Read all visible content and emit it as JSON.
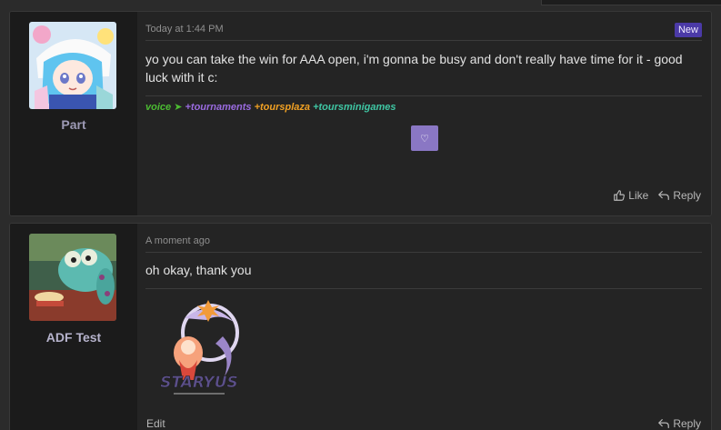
{
  "posts": [
    {
      "username": "Part",
      "timestamp": "Today at 1:44 PM",
      "badge": "New",
      "message": "yo you can take the win for AAA open, i'm gonna be busy and don't really have time for it - good luck with it c:",
      "signature": {
        "voice": "voice",
        "tournaments": "+tournaments",
        "toursplaza": "+toursplaza",
        "toursminigames": "+toursminigames"
      },
      "actions": {
        "like": "Like",
        "reply": "Reply"
      }
    },
    {
      "username": "ADF Test",
      "timestamp": "A moment ago",
      "message": "oh okay, thank you",
      "attachment_text": "STARYUS",
      "actions": {
        "edit": "Edit",
        "reply": "Reply"
      }
    }
  ],
  "colors": {
    "accent": "#4b3aa7",
    "signature_green": "#4cbc32",
    "signature_purple": "#9a6be0",
    "signature_orange": "#f0a023",
    "signature_teal": "#3fc7a4"
  },
  "icons": [
    "heart-icon",
    "like-icon",
    "reply-icon"
  ]
}
